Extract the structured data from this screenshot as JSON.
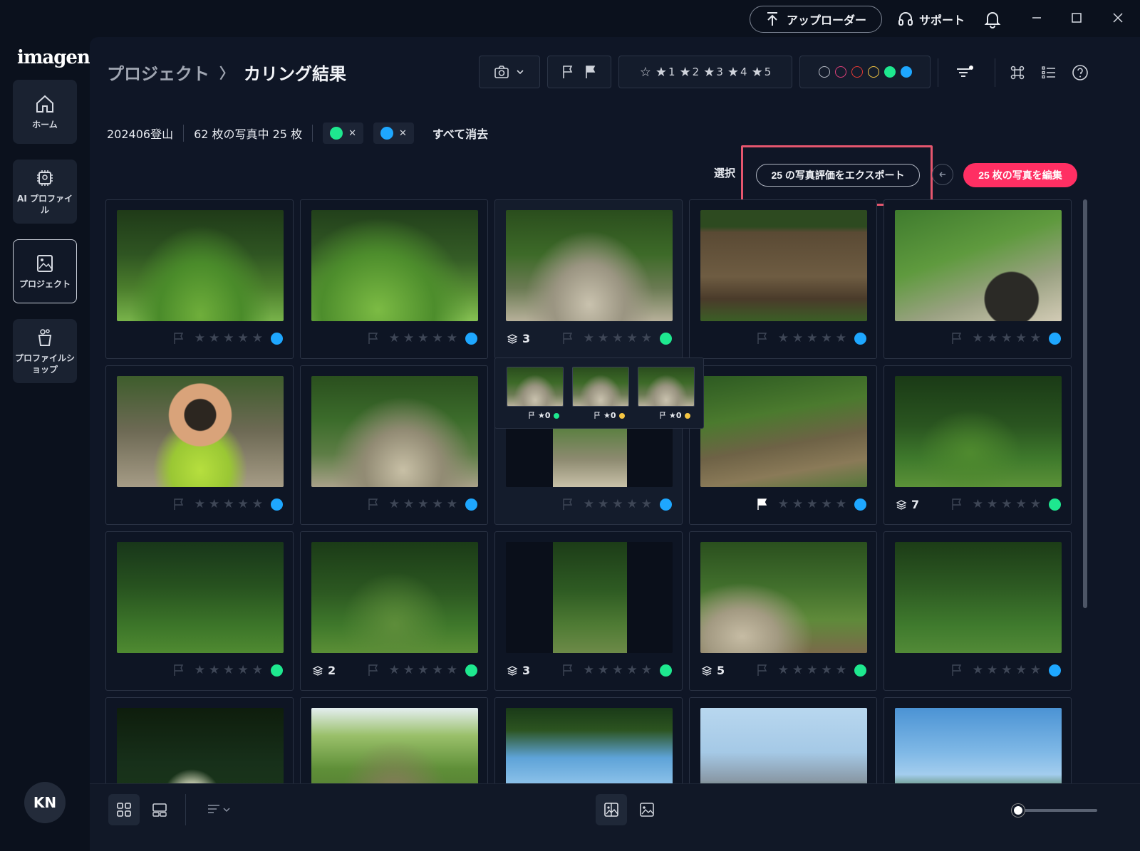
{
  "titlebar": {
    "uploader_label": "アップローダー",
    "support_label": "サポート"
  },
  "sidebar": {
    "logo": "imagen",
    "items": [
      {
        "label": "ホーム",
        "icon": "home-icon"
      },
      {
        "label": "AI プロファイル",
        "icon": "ai-chip-icon"
      },
      {
        "label": "プロジェクト",
        "icon": "project-image-icon"
      },
      {
        "label": "プロファイルショップ",
        "icon": "profile-shop-icon"
      }
    ],
    "avatar_initials": "KN"
  },
  "header": {
    "breadcrumb_parent": "プロジェクト",
    "breadcrumb_sep": "〉",
    "breadcrumb_current": "カリング結果",
    "star_filters": [
      "1",
      "2",
      "3",
      "4",
      "5"
    ],
    "color_filters_outline": [
      "#b9bec8",
      "#e0407a",
      "#e53935",
      "#f5c542"
    ],
    "color_filters_filled": [
      "#1ee88f",
      "#1ea7ff"
    ]
  },
  "filters": {
    "project_name": "202406登山",
    "count_text": "62 枚の写真中 25 枚",
    "chips": [
      {
        "color": "#1ee88f"
      },
      {
        "color": "#1ea7ff"
      }
    ],
    "chip_close": "✕",
    "clear_all": "すべて消去"
  },
  "actions": {
    "select_label": "選択",
    "export_label": "25 の写真評価をエクスポート",
    "edit_label": "25 枚の写真を編集"
  },
  "colors": {
    "green": "#1ee88f",
    "blue": "#1ea7ff",
    "yellow": "#f5c542",
    "accent": "#ff2f63"
  },
  "cards": [
    {
      "stack": "",
      "flagged": false,
      "dot": "#1ea7ff",
      "scene": "forest-sitting"
    },
    {
      "stack": "",
      "flagged": false,
      "dot": "#1ea7ff",
      "scene": "forest-sitting2"
    },
    {
      "stack": "3",
      "flagged": false,
      "dot": "#1ee88f",
      "scene": "trail-bridge"
    },
    {
      "stack": "",
      "flagged": false,
      "dot": "#1ea7ff",
      "scene": "signboard"
    },
    {
      "stack": "",
      "flagged": false,
      "dot": "#1ea7ff",
      "scene": "trail-kid"
    },
    {
      "stack": "",
      "flagged": false,
      "dot": "#1ea7ff",
      "scene": "kid-peace"
    },
    {
      "stack": "",
      "flagged": false,
      "dot": "#1ea7ff",
      "scene": "path-run"
    },
    {
      "stack": "",
      "flagged": false,
      "dot": "#1ea7ff",
      "scene": "portrait-path"
    },
    {
      "stack": "",
      "flagged": true,
      "dot": "#1ea7ff",
      "scene": "roots"
    },
    {
      "stack": "7",
      "flagged": false,
      "dot": "#1ee88f",
      "scene": "forest-walk"
    },
    {
      "stack": "",
      "flagged": false,
      "dot": "#1ee88f",
      "scene": "forest-walk2"
    },
    {
      "stack": "2",
      "flagged": false,
      "dot": "#1ee88f",
      "scene": "forest-walk3"
    },
    {
      "stack": "3",
      "flagged": false,
      "dot": "#1ee88f",
      "scene": "portrait-forest"
    },
    {
      "stack": "5",
      "flagged": false,
      "dot": "#1ee88f",
      "scene": "stump-trail"
    },
    {
      "stack": "",
      "flagged": false,
      "dot": "#1ea7ff",
      "scene": "bamboo-grass"
    },
    {
      "stack": "",
      "flagged": false,
      "dot": "",
      "scene": "dark-flower"
    },
    {
      "stack": "",
      "flagged": false,
      "dot": "",
      "scene": "group-rest"
    },
    {
      "stack": "",
      "flagged": false,
      "dot": "",
      "scene": "sky-view"
    },
    {
      "stack": "",
      "flagged": false,
      "dot": "",
      "scene": "city-view"
    },
    {
      "stack": "",
      "flagged": false,
      "dot": "",
      "scene": "sky-view2"
    }
  ],
  "stack_popup": [
    {
      "rating": "★0",
      "dot": "#1ee88f"
    },
    {
      "rating": "★0",
      "dot": "#f5c542"
    },
    {
      "rating": "★0",
      "dot": "#f5c542"
    }
  ]
}
